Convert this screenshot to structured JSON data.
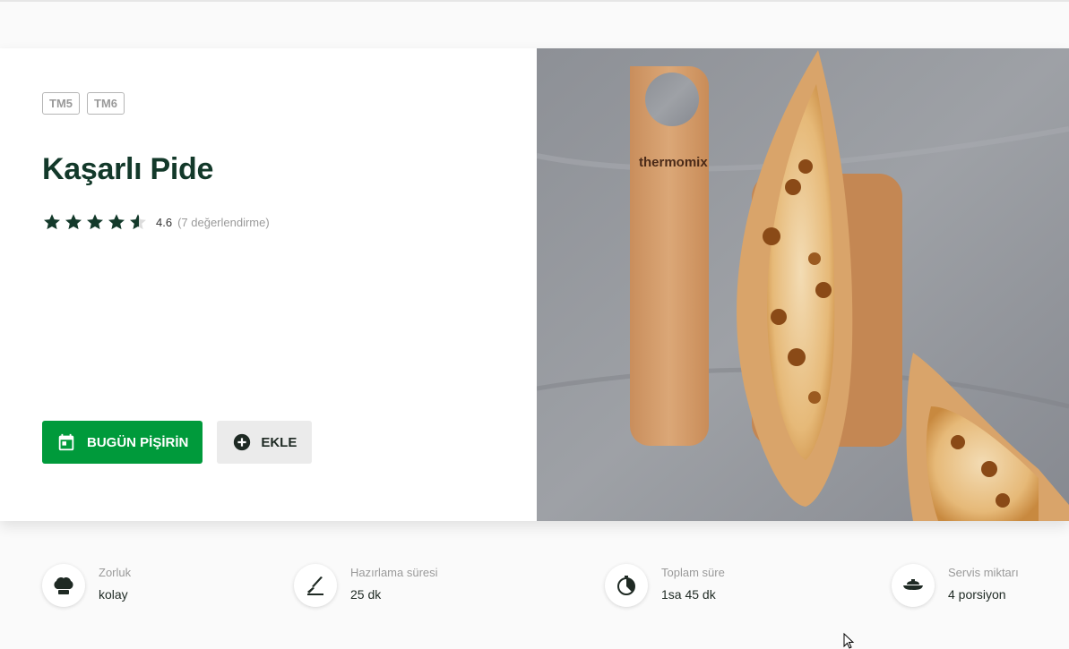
{
  "recipe": {
    "tags": [
      "TM5",
      "TM6"
    ],
    "title": "Kaşarlı Pide",
    "rating": {
      "value": "4.6",
      "count_label": "(7 değerlendirme)",
      "stars": 4.6
    },
    "actions": {
      "cook_today": "BUGÜN PİŞİRİN",
      "add": "EKLE"
    },
    "image": {
      "brand_label": "thermomix"
    }
  },
  "info": [
    {
      "label": "Zorluk",
      "value": "kolay",
      "icon": "chef-hat-icon"
    },
    {
      "label": "Hazırlama süresi",
      "value": "25 dk",
      "icon": "knife-icon"
    },
    {
      "label": "Toplam süre",
      "value": "1sa 45 dk",
      "icon": "timer-icon"
    },
    {
      "label": "Servis miktarı",
      "value": "4 porsiyon",
      "icon": "serving-dish-icon"
    }
  ],
  "colors": {
    "brand_green": "#009a3b",
    "title_green": "#13392a",
    "muted": "#9a9a9a"
  }
}
